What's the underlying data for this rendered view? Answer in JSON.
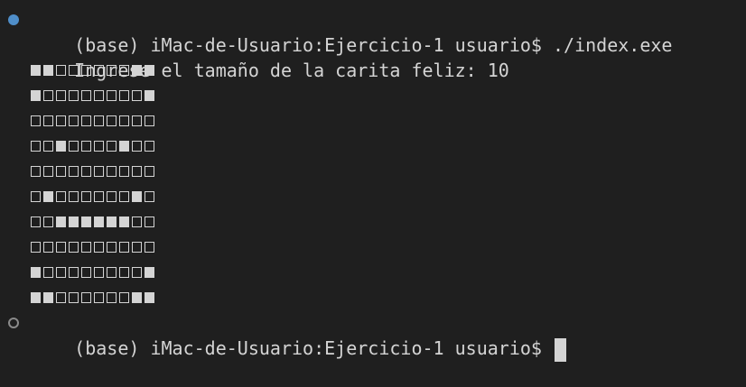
{
  "terminal": {
    "command_line": {
      "prompt": "(base) iMac-de-Usuario:Ejercicio-1 usuario$",
      "command": "./index.exe",
      "status": "success"
    },
    "output_line": "Ingrese el tamaño de la carita feliz: 10",
    "smiley_grid": [
      "1100000011",
      "1000000001",
      "0000000000",
      "0010000100",
      "0000000000",
      "0100000010",
      "0011111100",
      "0000000000",
      "1000000001",
      "1100000011"
    ],
    "active_prompt": {
      "prompt": "(base) iMac-de-Usuario:Ejercicio-1 usuario$",
      "status": "idle"
    }
  },
  "colors": {
    "background": "#1f1f1f",
    "foreground": "#d4d4d4",
    "success_dot": "#4f8ec9",
    "idle_dot": "#8a8a8a"
  },
  "icons": {
    "success_marker": "command-success-dot-icon",
    "idle_marker": "command-idle-dot-icon"
  }
}
